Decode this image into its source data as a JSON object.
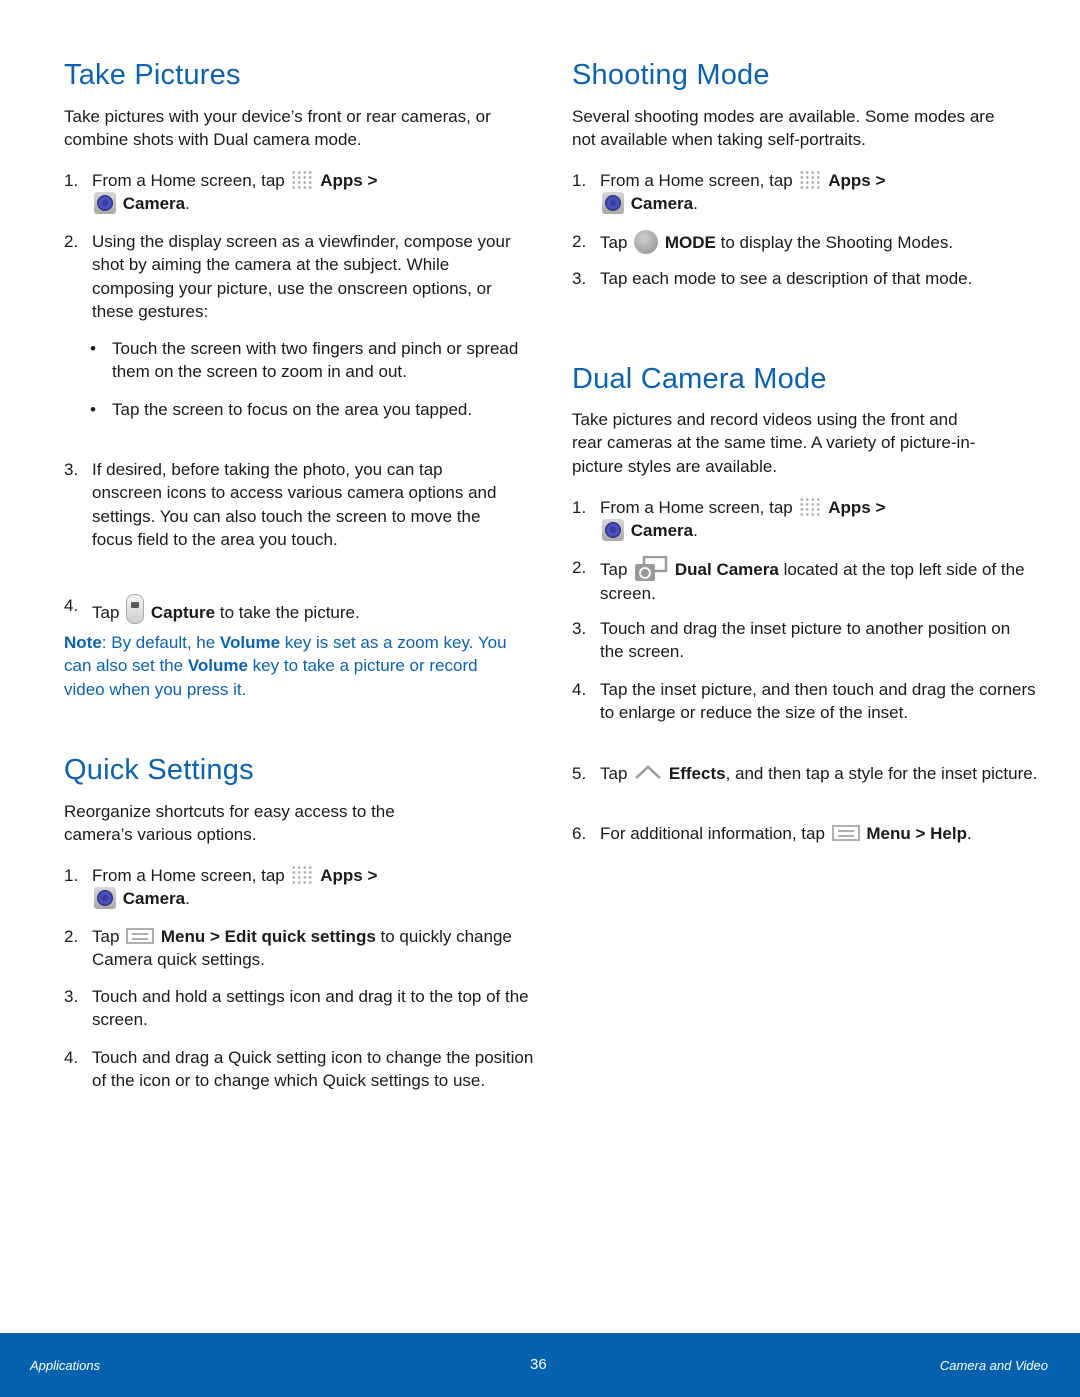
{
  "sections": {
    "take_pictures": {
      "title": "Take Pictures",
      "intro": "Take pictures with your device’s front or rear cameras, or combine shots with Dual camera mode.",
      "step1": {
        "num": "1.",
        "pre": "From a Home screen, tap",
        "apps": "Apps >",
        "camera": "Camera",
        "end": "."
      },
      "step2": {
        "num": "2.",
        "text": "Using the display screen as a viewfinder, compose your shot by aiming the camera at the subject. While composing your picture, use the onscreen options, or these gestures:"
      },
      "bullets": [
        "Touch the screen with two fingers and pinch or spread them on the screen to zoom in and out.",
        "Tap the screen to focus on the area you tapped."
      ],
      "bullet_char": "•",
      "step3": {
        "num": "3.",
        "text": "If desired, before taking the photo, you can tap onscreen icons to access various camera options and settings. You can also touch the screen to move the focus field to the area you touch."
      },
      "step4": {
        "num": "4.",
        "pre": "Tap",
        "bold": "Capture",
        "post": "to take the picture."
      },
      "note": {
        "label": "Note",
        "part1": ": By default, he ",
        "bold1": "Volume",
        "part2": " key is set as a zoom key. You can also set the ",
        "bold2": "Volume",
        "part3": " key to take a picture or record video when you press it."
      }
    },
    "quick_settings": {
      "title": "Quick Settings",
      "intro": "Reorganize shortcuts for easy access to the camera’s various options.",
      "step1": {
        "num": "1.",
        "pre": "From a Home screen, tap",
        "apps": "Apps >",
        "camera": "Camera",
        "end": "."
      },
      "step2": {
        "num": "2.",
        "pre": "Tap",
        "bold": "Menu > Edit quick settings",
        "post": "to quickly change Camera quick settings."
      },
      "step3": {
        "num": "3.",
        "text": "Touch and hold a settings icon and drag it to the top of the screen."
      },
      "step4": {
        "num": "4.",
        "text": "Touch and drag a Quick setting icon to change the position of the icon or to change which Quick settings to use."
      }
    },
    "shooting_mode": {
      "title": "Shooting Mode",
      "intro": "Several shooting modes are available. Some modes are not available when taking self-portraits.",
      "step1": {
        "num": "1.",
        "pre": "From a Home screen, tap",
        "apps": "Apps >",
        "camera": "Camera",
        "end": "."
      },
      "step2": {
        "num": "2.",
        "pre": "Tap",
        "bold": "MODE",
        "post": "to display the Shooting Modes."
      },
      "step3": {
        "num": "3.",
        "text": "Tap each mode to see a description of that mode."
      }
    },
    "dual_camera": {
      "title": "Dual Camera Mode",
      "intro": "Take pictures and record videos using the front and rear cameras at the same time. A variety of picture-in-picture styles are available.",
      "step1": {
        "num": "1.",
        "pre": "From a Home screen, tap",
        "apps": "Apps >",
        "camera": "Camera",
        "end": "."
      },
      "step2": {
        "num": "2.",
        "pre": "Tap",
        "bold": "Dual Camera",
        "post": "located at the top left side of the screen."
      },
      "step3": {
        "num": "3.",
        "text": "Touch and drag the inset picture to another position on the screen."
      },
      "step4": {
        "num": "4.",
        "text": "Tap the inset picture, and then touch and drag the corners to enlarge or reduce the size of the inset."
      },
      "step5": {
        "num": "5.",
        "pre": "Tap",
        "bold": "Effects",
        "post": ", and then tap a style for the inset picture."
      },
      "step6": {
        "num": "6.",
        "pre": "For additional information, tap",
        "bold": "Menu > Help",
        "end": "."
      }
    }
  },
  "icons": {
    "apps": "apps-grid-icon",
    "camera": "camera-app-icon",
    "capture": "capture-button-icon",
    "mode": "mode-button-icon",
    "menu": "menu-icon",
    "dual_camera": "dual-camera-icon",
    "effects": "effects-chevron-icon"
  },
  "footer": {
    "left": "Applications",
    "page": "36",
    "right": "Camera and Video"
  },
  "colors": {
    "heading": "#0b62b0",
    "note": "#0b62b0",
    "footer_bg": "#0561ad"
  }
}
